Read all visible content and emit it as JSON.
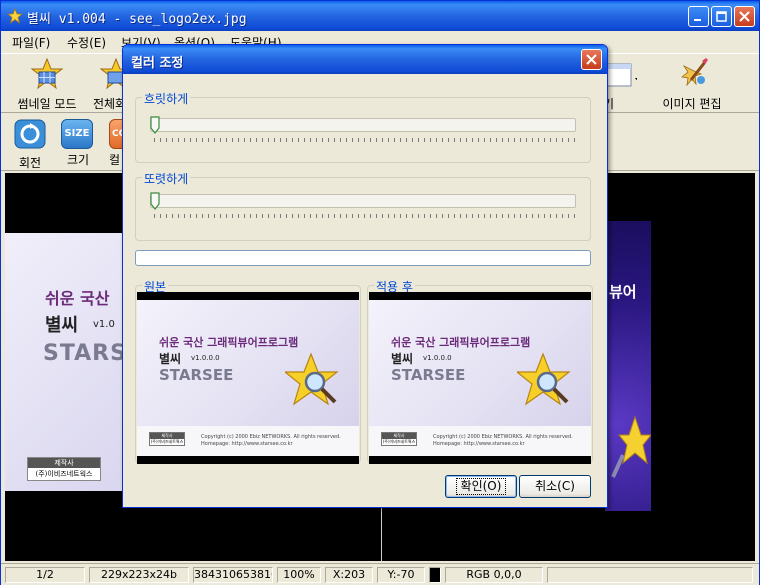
{
  "app": {
    "title": "별씨 v1.004 - see_logo2ex.jpg"
  },
  "menu": [
    {
      "label": "파일(F)"
    },
    {
      "label": "수정(E)"
    },
    {
      "label": "보기(V)"
    },
    {
      "label": "옵션(O)"
    },
    {
      "label": "도움말(H)"
    }
  ],
  "toolbar1": [
    {
      "label": "썸네일 모드",
      "icon": "star-grid-icon"
    },
    {
      "label": "전체화",
      "icon": "star-fullscreen-icon"
    },
    {
      "label": "기",
      "icon": "view-icon"
    },
    {
      "label": "이미지 편집",
      "icon": "edit-brush-icon"
    }
  ],
  "toolbar2": [
    {
      "label": "회전",
      "icon": "rotate-icon"
    },
    {
      "label": "크기",
      "icon": "size-icon",
      "icon_text": "SIZE"
    },
    {
      "label": "컬",
      "icon": "color-icon",
      "icon_text": "CO"
    }
  ],
  "status": {
    "page": "1/2",
    "dimensions": "229x223x24b",
    "filesize": "384310653816(",
    "zoom": "100%",
    "x": "X:203",
    "y": "Y:-70",
    "rgb": "RGB 0,0,0"
  },
  "dialog": {
    "title": "컬러 조정",
    "blur_label": "흐릿하게",
    "sharpen_label": "또렷하게",
    "blur_value": 0,
    "sharpen_value": 0,
    "progress": 0,
    "original_label": "원본",
    "after_label": "적용 후",
    "ok_label": "확인(O)",
    "cancel_label": "취소(C)"
  },
  "preview": {
    "line1": "쉬운 국산 그래픽뷰어프로그램",
    "line2": "별씨",
    "version": "v1.0.0.0",
    "brand": "STARSEE",
    "maker": "제작사",
    "maker_name": "(주)이비즈네트웍스",
    "copyright": "Copyright (c) 2000 Ebiz NETWORKS. All rights reserved.",
    "homepage": "Homepage: http://www.starsee.co.kr"
  },
  "background": {
    "line1": "쉬운 국산",
    "line2": "별씨",
    "version": "v1.0",
    "brand": "STARS",
    "maker": "제작사",
    "maker_name": "(주)이비즈네트웍스",
    "right_text": "뷰어"
  },
  "colors": {
    "title_blue": "#2465e0",
    "group_label": "#0046d5",
    "brand_purple": "#6b2a7a"
  }
}
